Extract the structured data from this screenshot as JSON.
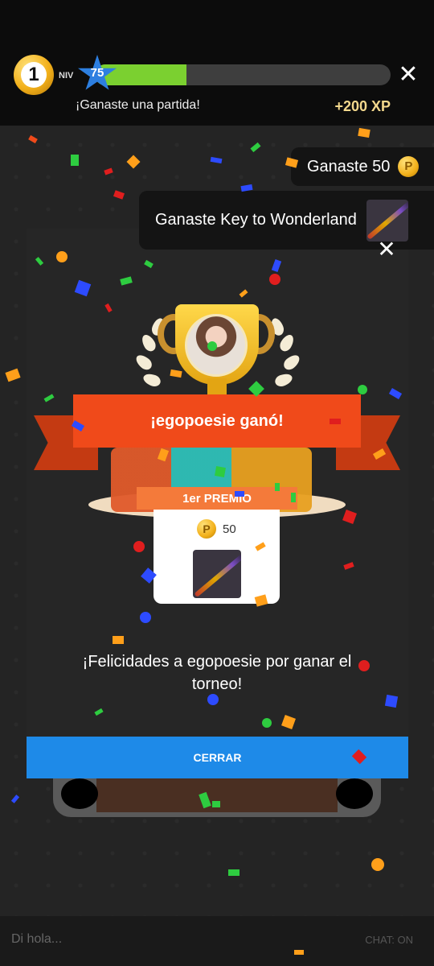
{
  "header": {
    "rank_number": "1",
    "level_label": "NIV",
    "level_value": "75",
    "xp_progress_fraction": 0.31,
    "status_text": "¡Ganaste una partida!",
    "xp_gain": "+200 XP",
    "close_symbol": "✕"
  },
  "toasts": [
    {
      "text": "Ganaste 50",
      "icon": "coin-icon"
    },
    {
      "text": "Ganaste Key to Wonderland",
      "icon": "cue-icon"
    }
  ],
  "modal": {
    "close_symbol": "✕",
    "winner_banner": "¡egopoesie ganó!",
    "prize_label": "1er PREMIO",
    "prize_coins": "50",
    "coin_symbol": "P",
    "message": "¡Felicidades a egopoesie por ganar el torneo!",
    "close_button": "CERRAR"
  },
  "chat": {
    "placeholder": "Di hola...",
    "toggle_label": "CHAT: ON"
  },
  "colors": {
    "xp_fill": "#7bd030",
    "level_star": "#2d7fe0",
    "banner": "#f04a1a",
    "button": "#1e8ae8",
    "xp_text": "#f3d88d"
  }
}
